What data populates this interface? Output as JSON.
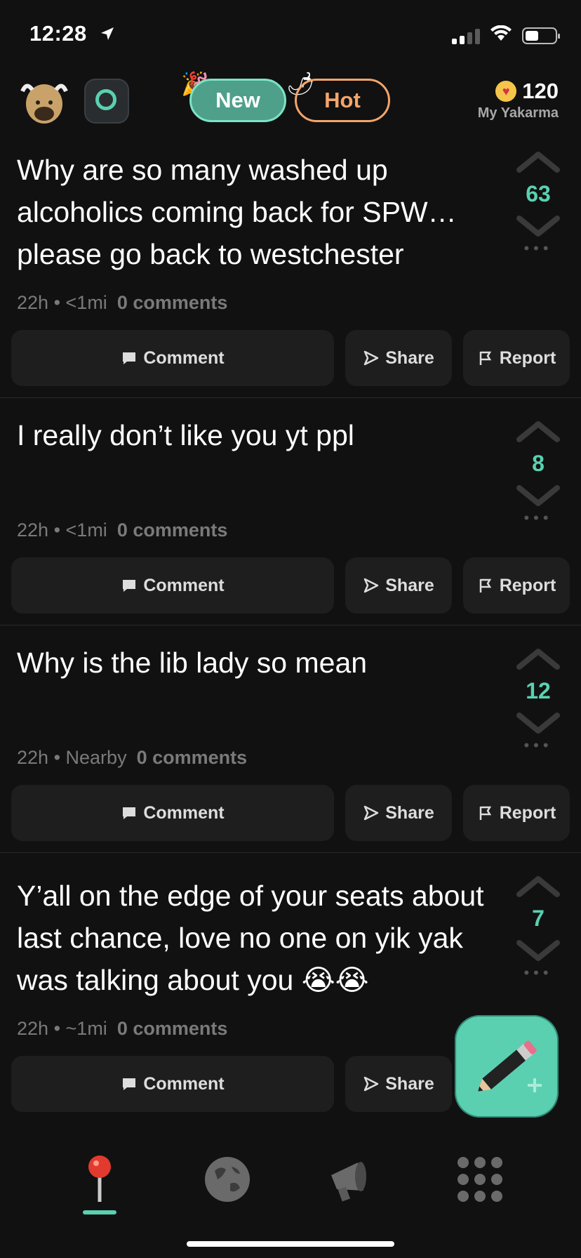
{
  "status": {
    "time": "12:28"
  },
  "header": {
    "tabs": [
      {
        "label": "New",
        "active": true
      },
      {
        "label": "Hot",
        "active": false
      }
    ],
    "karma": {
      "value": "120",
      "label": "My Yakarma"
    }
  },
  "posts": [
    {
      "text": "Why are so many washed up alcoholics coming back for SPW… please go back to westchester",
      "score": "63",
      "time": "22h",
      "distance": "<1mi",
      "comments": "0 comments"
    },
    {
      "text": "I really don’t like you yt ppl",
      "score": "8",
      "time": "22h",
      "distance": "<1mi",
      "comments": "0 comments"
    },
    {
      "text": "Why is the lib lady so mean",
      "score": "12",
      "time": "22h",
      "distance": "Nearby",
      "comments": "0 comments"
    },
    {
      "text": "Y’all on the edge of your seats about last chance, love no one on yik yak was talking about you 😭😭",
      "score": "7",
      "time": "22h",
      "distance": "~1mi",
      "comments": "0 comments"
    }
  ],
  "actions": {
    "comment": "Comment",
    "share": "Share",
    "report": "Report"
  },
  "colors": {
    "accent": "#5ad0b1",
    "hot": "#f3a56b",
    "background": "#111111",
    "button": "#1e1e1e"
  },
  "icons": [
    "location-arrow-icon",
    "signal-icon",
    "wifi-icon",
    "battery-icon",
    "yak-avatar-icon",
    "school-badge-icon",
    "party-icon",
    "pepper-icon",
    "heart-icon",
    "upvote-icon",
    "downvote-icon",
    "more-icon",
    "comment-icon",
    "share-icon",
    "report-icon",
    "pencil-icon",
    "pin-icon",
    "globe-icon",
    "megaphone-icon",
    "grid-icon"
  ]
}
